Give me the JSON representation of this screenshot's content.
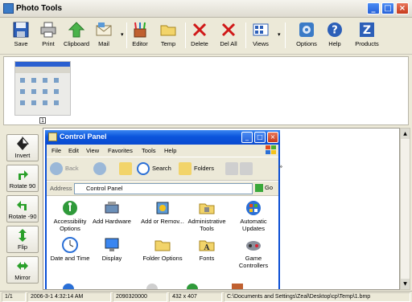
{
  "window": {
    "title": "Photo Tools"
  },
  "toolbar": {
    "save": "Save",
    "print": "Print",
    "clipboard": "Clipboard",
    "mail": "Mail",
    "editor": "Editor",
    "temp": "Temp",
    "delete": "Delete",
    "del_all": "Del All",
    "views": "Views",
    "options": "Options",
    "help": "Help",
    "products": "Products"
  },
  "thumbnail": {
    "badge": "1"
  },
  "left_panel": {
    "invert": "Invert",
    "rotate_90": "Rotate 90",
    "rotate_neg_90": "Rotate -90",
    "flip": "Flip",
    "mirror": "Mirror"
  },
  "control_panel": {
    "title": "Control Panel",
    "menu": [
      "File",
      "Edit",
      "View",
      "Favorites",
      "Tools",
      "Help"
    ],
    "toolbar": {
      "back": "Back",
      "search": "Search",
      "folders": "Folders"
    },
    "address_label": "Address",
    "address_value": "Control Panel",
    "go": "Go",
    "items": [
      "Accessibility Options",
      "Add Hardware",
      "Add or Remov...",
      "Administrative Tools",
      "Automatic Updates",
      "Date and Time",
      "Display",
      "Folder Options",
      "Fonts",
      "Game Controllers"
    ]
  },
  "status": {
    "index": "1/1",
    "datetime": "2006-3-1 4:32:14 AM",
    "size": "2090320000",
    "dimensions": "432 x 407",
    "path": "C:\\Documents and Settings\\Zeal\\Desktop\\cp\\Temp\\1.bmp"
  }
}
